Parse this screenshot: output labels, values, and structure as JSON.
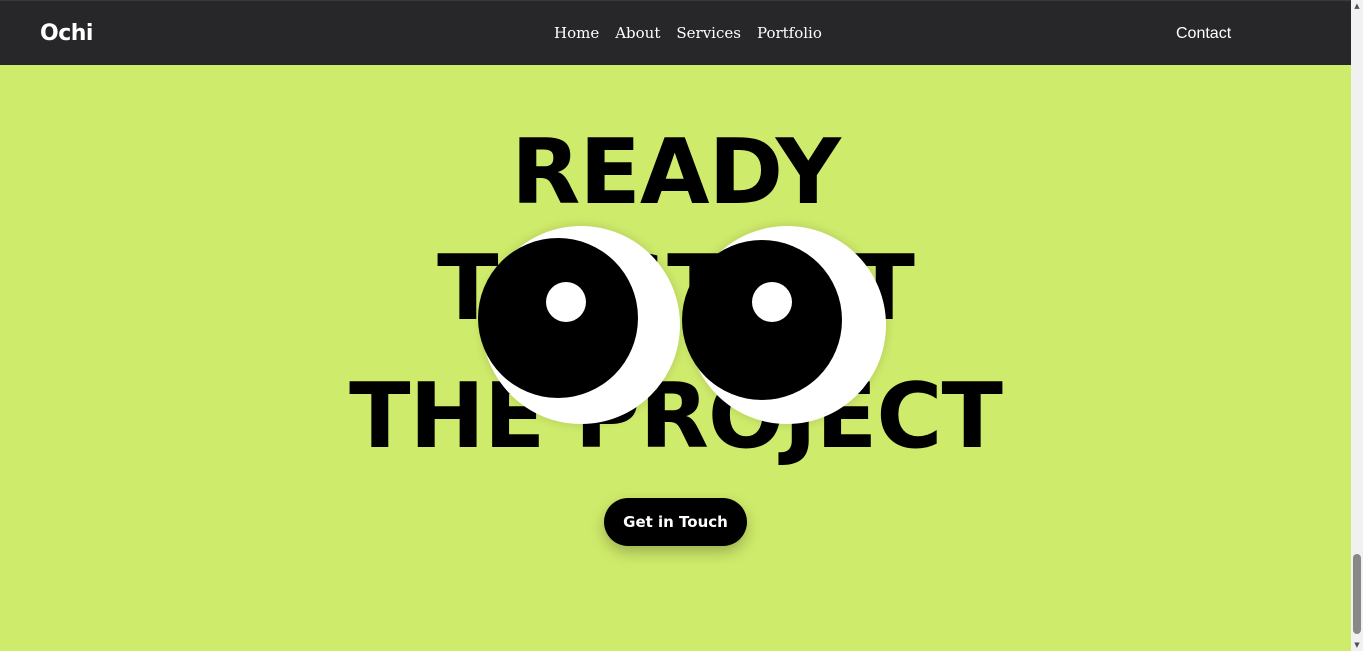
{
  "nav": {
    "logo": "Ochi",
    "links": [
      "Home",
      "About",
      "Services",
      "Portfolio"
    ],
    "contact": "Contact"
  },
  "hero": {
    "line1": "READY",
    "line2": "TO START",
    "line3": "THE PROJECT",
    "cta": "Get in Touch"
  },
  "colors": {
    "background": "#cfeb6b",
    "navbar": "#27272a",
    "text": "#000000"
  },
  "icons": {
    "scroll_up": "arrow-up-icon",
    "scroll_down": "arrow-down-icon"
  }
}
